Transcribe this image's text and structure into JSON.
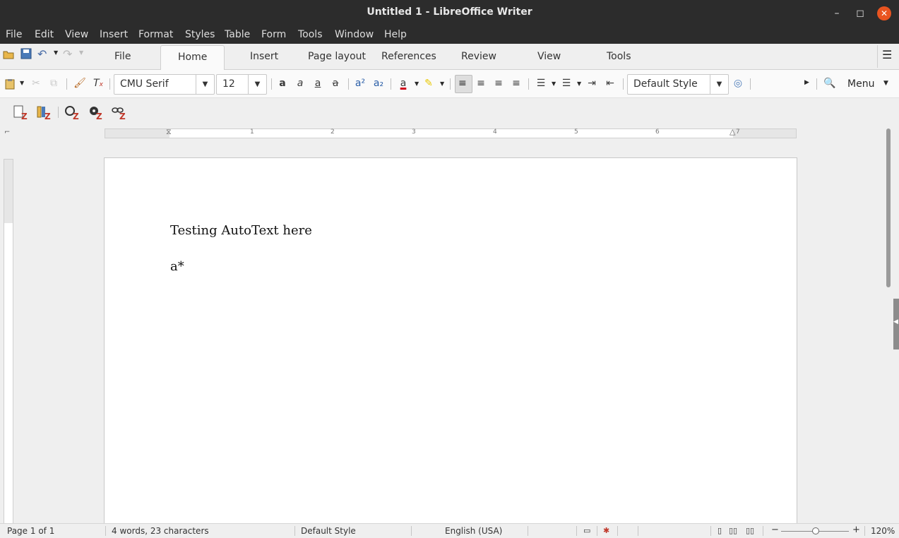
{
  "window": {
    "title": "Untitled 1 - LibreOffice Writer",
    "minimize": "–",
    "maximize": "◻",
    "close": "✕"
  },
  "menubar": [
    "File",
    "Edit",
    "View",
    "Insert",
    "Format",
    "Styles",
    "Table",
    "Form",
    "Tools",
    "Window",
    "Help"
  ],
  "tabs": [
    "File",
    "Home",
    "Insert",
    "Page layout",
    "References",
    "Review",
    "View",
    "Tools"
  ],
  "active_tab": "Home",
  "toolbar": {
    "font_name": "CMU Serif",
    "font_size": "12",
    "paragraph_style": "Default Style",
    "menu_label": "Menu"
  },
  "ruler": {
    "numbers": [
      "1",
      "2",
      "3",
      "4",
      "5",
      "6",
      "7"
    ]
  },
  "document": {
    "lines": [
      "Testing AutoText here",
      "a*"
    ]
  },
  "status": {
    "page": "Page 1 of 1",
    "words": "4 words, 23 characters",
    "style": "Default Style",
    "language": "English (USA)",
    "zoom": "120%"
  }
}
